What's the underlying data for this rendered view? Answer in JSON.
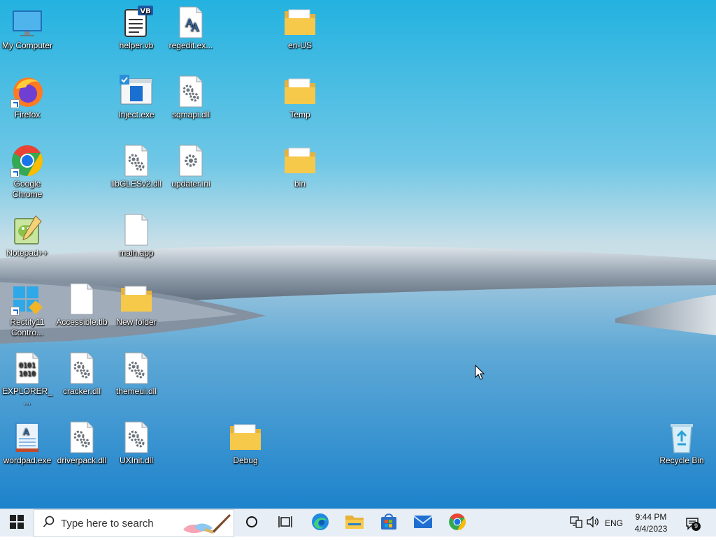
{
  "desktop": {
    "icons": {
      "my_computer": "My Computer",
      "firefox": "Firefox",
      "chrome": "Google Chrome",
      "notepadpp": "Notepad++",
      "rectify11": "Rectify11 Contro...",
      "explorer": "EXPLORER_...",
      "wordpad": "wordpad.exe",
      "accessible": "Accessible.tlb",
      "cracker": "cracker.dll",
      "driverpack": "driverpack.dll",
      "helper": "helper.vb",
      "inject": "Inject.exe",
      "libgles": "libGLESv2.dll",
      "mainapp": "main.app",
      "newfolder": "New folder",
      "themeui": "themeui.dll",
      "uxinit": "UXInit.dll",
      "regedit": "regedit.ex...",
      "sqmapi": "sqmapi.dll",
      "updater": "updater.ini",
      "debug": "Debug",
      "enus": "en-US",
      "temp": "Temp",
      "bin": "bin",
      "recycle": "Recycle Bin"
    },
    "vb_badge": "VB",
    "binary_glyph": "0101\n1010"
  },
  "taskbar": {
    "search_placeholder": "Type here to search",
    "language": "ENG",
    "time": "9:44 PM",
    "date": "4/4/2023",
    "notification_count": "9"
  },
  "colors": {
    "folder": "#f6c94a",
    "taskbar_bg": "#e8eef5",
    "accent": "#0a6cd1"
  }
}
